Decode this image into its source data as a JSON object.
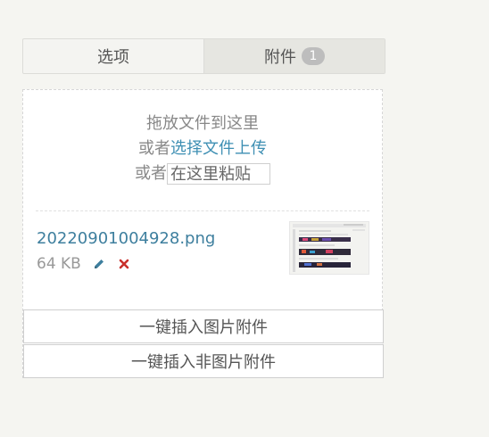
{
  "tabs": [
    {
      "label": "选项",
      "active": false
    },
    {
      "label": "附件",
      "active": true,
      "badge": "1"
    }
  ],
  "drop": {
    "line1": "拖放文件到这里",
    "line2_prefix": "或者",
    "line2_link": "选择文件上传",
    "line3_prefix": "或者",
    "paste_label": "在这里粘贴"
  },
  "file": {
    "name": "20220901004928.png",
    "size": "64 KB",
    "edit_icon": "pencil-icon",
    "delete_icon": "close-icon"
  },
  "buttons": {
    "insert_images": "一键插入图片附件",
    "insert_non_images": "一键插入非图片附件"
  },
  "colors": {
    "link": "#3e8fb3",
    "delete": "#c9302c",
    "edit": "#3e7f9e"
  }
}
